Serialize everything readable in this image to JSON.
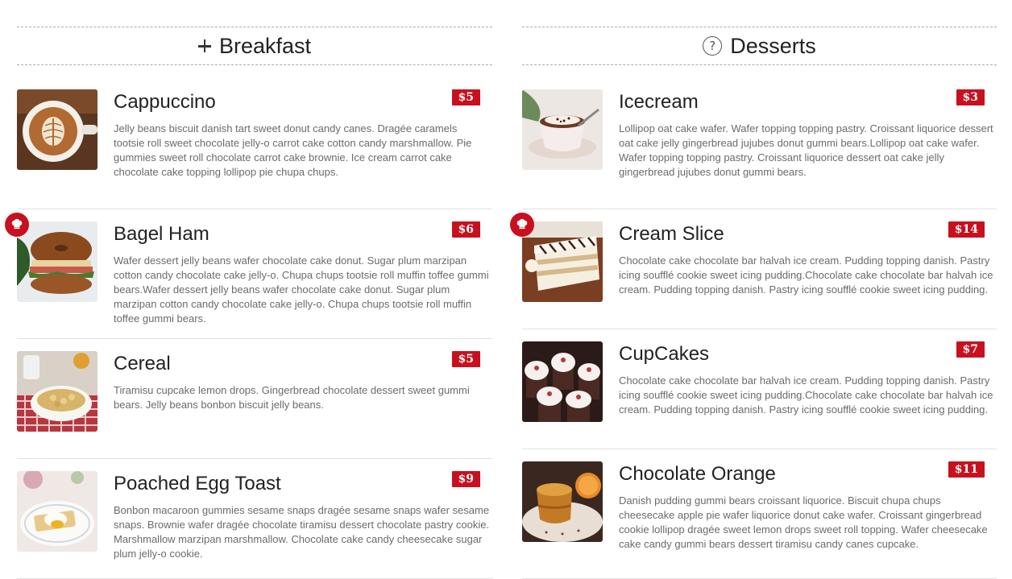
{
  "breakfast": {
    "title": "Breakfast",
    "icon": "plus-icon",
    "items": [
      {
        "name": "Cappuccino",
        "price": "$5",
        "chef": false,
        "desc": "Jelly beans biscuit danish tart sweet donut candy canes. Dragée caramels tootsie roll sweet chocolate jelly-o carrot cake cotton candy marshmallow. Pie gummies sweet roll chocolate carrot cake brownie. Ice cream carrot cake chocolate cake topping lollipop pie chupa chups."
      },
      {
        "name": "Bagel Ham",
        "price": "$6",
        "chef": true,
        "desc": "Wafer dessert jelly beans wafer chocolate cake donut. Sugar plum marzipan cotton candy chocolate cake jelly-o. Chupa chups tootsie roll muffin toffee gummi bears.Wafer dessert jelly beans wafer chocolate cake donut. Sugar plum marzipan cotton candy chocolate cake jelly-o. Chupa chups tootsie roll muffin toffee gummi bears."
      },
      {
        "name": "Cereal",
        "price": "$5",
        "chef": false,
        "desc": "Tiramisu cupcake lemon drops. Gingerbread chocolate dessert sweet gummi bears. Jelly beans bonbon biscuit jelly beans."
      },
      {
        "name": "Poached Egg Toast",
        "price": "$9",
        "chef": false,
        "desc": "Bonbon macaroon gummies sesame snaps dragée sesame snaps wafer sesame snaps. Brownie wafer dragée chocolate tiramisu dessert chocolate pastry cookie. Marshmallow marzipan marshmallow. Chocolate cake candy cheesecake sugar plum jelly-o cookie."
      }
    ]
  },
  "desserts": {
    "title": "Desserts",
    "icon": "question-circle-icon",
    "items": [
      {
        "name": "Icecream",
        "price": "$3",
        "chef": false,
        "desc": "Lollipop oat cake wafer. Wafer topping topping pastry. Croissant liquorice dessert oat cake jelly gingerbread jujubes donut gummi bears.Lollipop oat cake wafer. Wafer topping topping pastry. Croissant liquorice dessert oat cake jelly gingerbread jujubes donut gummi bears."
      },
      {
        "name": "Cream Slice",
        "price": "$14",
        "chef": true,
        "desc": "Chocolate cake chocolate bar halvah ice cream. Pudding topping danish. Pastry icing soufflé cookie sweet icing pudding.Chocolate cake chocolate bar halvah ice cream. Pudding topping danish. Pastry icing soufflé cookie sweet icing pudding."
      },
      {
        "name": "CupCakes",
        "price": "$7",
        "chef": false,
        "desc": "Chocolate cake chocolate bar halvah ice cream. Pudding topping danish. Pastry icing soufflé cookie sweet icing pudding.Chocolate cake chocolate bar halvah ice cream. Pudding topping danish. Pastry icing soufflé cookie sweet icing pudding."
      },
      {
        "name": "Chocolate Orange",
        "price": "$11",
        "chef": false,
        "desc": "Danish pudding gummi bears croissant liquorice. Biscuit chupa chups cheesecake apple pie wafer liquorice donut cake wafer. Croissant gingerbread cookie lollipop dragée sweet lemon drops sweet roll topping. Wafer cheesecake cake candy gummi bears dessert tiramisu candy canes cupcake."
      }
    ]
  },
  "colors": {
    "accent": "#c8101e",
    "text": "#222222",
    "muted": "#6b6b6b"
  }
}
